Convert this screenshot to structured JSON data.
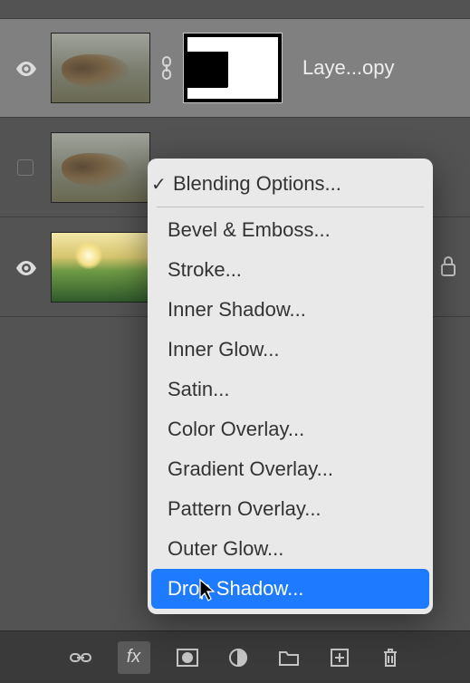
{
  "layers": [
    {
      "name": "Laye...opy",
      "visible": true,
      "mask": true,
      "selected": true
    },
    {
      "name": "",
      "visible": false,
      "mask": false
    },
    {
      "name": "",
      "visible": true,
      "mask": false,
      "locked": true
    }
  ],
  "fx_menu": {
    "checked_label": "Blending Options...",
    "items": [
      "Bevel & Emboss...",
      "Stroke...",
      "Inner Shadow...",
      "Inner Glow...",
      "Satin...",
      "Color Overlay...",
      "Gradient Overlay...",
      "Pattern Overlay...",
      "Outer Glow..."
    ],
    "highlighted": "Drop Shadow..."
  },
  "toolbar": {
    "link": "link",
    "fx": "fx",
    "mask": "mask",
    "adjust": "adjust",
    "group": "group",
    "new": "new",
    "trash": "trash"
  }
}
